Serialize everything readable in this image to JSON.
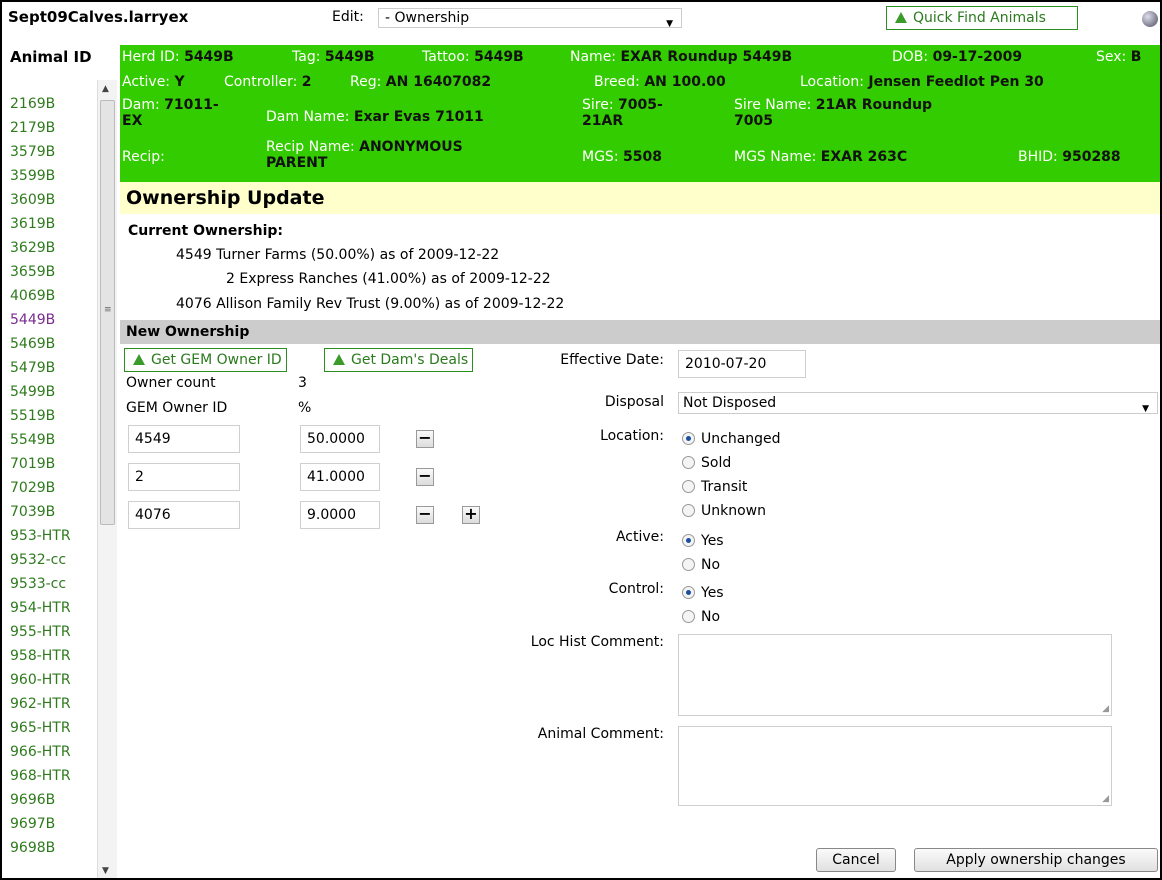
{
  "app_title": "Sept09Calves.larryex",
  "edit": {
    "label": "Edit:",
    "selected": "- Ownership"
  },
  "quick_find_label": "Quick Find Animals",
  "sidebar": {
    "header": "Animal ID",
    "selected": "5449B",
    "items": [
      "2169B",
      "2179B",
      "3579B",
      "3599B",
      "3609B",
      "3619B",
      "3629B",
      "3659B",
      "4069B",
      "5449B",
      "5469B",
      "5479B",
      "5499B",
      "5519B",
      "5549B",
      "7019B",
      "7029B",
      "7039B",
      "953-HTR",
      "9532-cc",
      "9533-cc",
      "954-HTR",
      "955-HTR",
      "958-HTR",
      "960-HTR",
      "962-HTR",
      "965-HTR",
      "966-HTR",
      "968-HTR",
      "9696B",
      "9697B",
      "9698B"
    ]
  },
  "animal": {
    "herd_id_label": "Herd ID:",
    "herd_id": "5449B",
    "tag_label": "Tag:",
    "tag": "5449B",
    "tattoo_label": "Tattoo:",
    "tattoo": "5449B",
    "name_label": "Name:",
    "name": "EXAR Roundup 5449B",
    "dob_label": "DOB:",
    "dob": "09-17-2009",
    "sex_label": "Sex:",
    "sex": "B",
    "active_label": "Active:",
    "active": "Y",
    "controller_label": "Controller:",
    "controller": "2",
    "reg_label": "Reg:",
    "reg": "AN 16407082",
    "breed_label": "Breed:",
    "breed": "AN 100.00",
    "location_label": "Location:",
    "location": "Jensen Feedlot Pen 30",
    "dam_label": "Dam:",
    "dam_1": "71011-",
    "dam_2": "EX",
    "dam_name_label": "Dam Name:",
    "dam_name": "Exar Evas 71011",
    "sire_label": "Sire:",
    "sire_1": "7005-",
    "sire_2": "21AR",
    "sire_name_label": "Sire Name:",
    "sire_name_1": "21AR Roundup",
    "sire_name_2": "7005",
    "recip_label": "Recip:",
    "recip_name_label": "Recip Name:",
    "recip_name_1": "ANONYMOUS",
    "recip_name_2": "PARENT",
    "mgs_label": "MGS:",
    "mgs": "5508",
    "mgs_name_label": "MGS Name:",
    "mgs_name": "EXAR 263C",
    "bhid_label": "BHID:",
    "bhid": "950288"
  },
  "ownership_update_title": "Ownership Update",
  "current_ownership": {
    "label": "Current Ownership:",
    "lines": [
      "4549 Turner Farms (50.00%) as of 2009-12-22",
      "2 Express Ranches (41.00%) as of 2009-12-22",
      "4076 Allison Family Rev Trust (9.00%) as of 2009-12-22"
    ]
  },
  "new_ownership": {
    "title": "New Ownership",
    "get_owner_btn": "Get GEM Owner ID",
    "get_dam_btn": "Get Dam's Deals",
    "owner_count_label": "Owner count",
    "owner_count": "3",
    "col_owner": "GEM Owner ID",
    "col_pct": "%",
    "owners": [
      {
        "id": "4549",
        "pct": "50.0000"
      },
      {
        "id": "2",
        "pct": "41.0000"
      },
      {
        "id": "4076",
        "pct": "9.0000"
      }
    ],
    "minus": "−",
    "plus": "+"
  },
  "form": {
    "effective_date_label": "Effective Date:",
    "effective_date": "2010-07-20",
    "disposal_label": "Disposal",
    "disposal": "Not Disposed",
    "location_label": "Location:",
    "location_options": [
      "Unchanged",
      "Sold",
      "Transit",
      "Unknown"
    ],
    "location_selected": "Unchanged",
    "active_label": "Active:",
    "active_options": [
      "Yes",
      "No"
    ],
    "control_label": "Control:",
    "control_options": [
      "Yes",
      "No"
    ],
    "loc_hist_label": "Loc Hist Comment:",
    "animal_comment_label": "Animal Comment:"
  },
  "buttons": {
    "cancel": "Cancel",
    "apply": "Apply ownership changes"
  }
}
